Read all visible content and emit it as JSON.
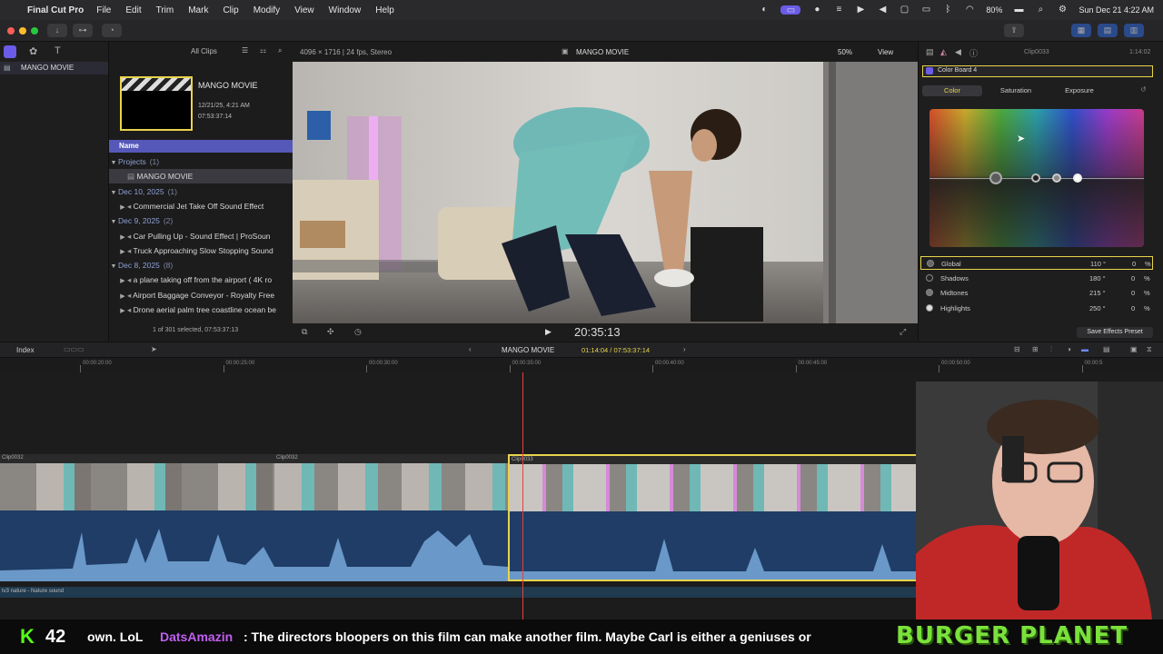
{
  "menubar": {
    "app": "Final Cut Pro",
    "menus": [
      "File",
      "Edit",
      "Trim",
      "Mark",
      "Clip",
      "Modify",
      "View",
      "Window",
      "Help"
    ],
    "battery": "80%",
    "clock": "Sun Dec 21  4:22 AM"
  },
  "browser": {
    "filter": "All Clips",
    "library": "MANGO MOVIE",
    "event_title": "MANGO MOVIE",
    "event_date": "12/21/25, 4:21 AM",
    "event_duration": "07:53:37:14",
    "column_name": "Name",
    "rows": [
      {
        "label": "Projects",
        "count": "(1)",
        "group": true
      },
      {
        "label": "MANGO MOVIE",
        "count": "",
        "group": false,
        "selected": true
      },
      {
        "label": "Dec 10, 2025",
        "count": "(1)",
        "group": true
      },
      {
        "label": "Commercial Jet Take Off Sound Effect",
        "count": "",
        "group": false
      },
      {
        "label": "Dec 9, 2025",
        "count": "(2)",
        "group": true
      },
      {
        "label": "Car Pulling Up - Sound Effect  |  ProSoun",
        "count": "",
        "group": false
      },
      {
        "label": "Truck Approaching Slow Stopping Sound",
        "count": "",
        "group": false
      },
      {
        "label": "Dec 8, 2025",
        "count": "(8)",
        "group": true
      },
      {
        "label": "a plane taking off from the airport ( 4K ro",
        "count": "",
        "group": false
      },
      {
        "label": "Airport Baggage Conveyor - Royalty Free",
        "count": "",
        "group": false
      },
      {
        "label": "Drone aerial palm tree coastline ocean be",
        "count": "",
        "group": false
      }
    ],
    "status": "1 of 301 selected, 07:53:37:13"
  },
  "viewer": {
    "format": "4096 × 1716 | 24 fps, Stereo",
    "title": "MANGO MOVIE",
    "zoom": "50%",
    "view": "View",
    "timecode": "20:35:13"
  },
  "inspector": {
    "clip": "Clip0033",
    "duration": "1:14:02",
    "board": "Color Board 4",
    "tabs": [
      "Color",
      "Saturation",
      "Exposure"
    ],
    "rows": [
      {
        "label": "Global",
        "angle": "110 °",
        "value": "0",
        "unit": "%"
      },
      {
        "label": "Shadows",
        "angle": "180 °",
        "value": "0",
        "unit": "%"
      },
      {
        "label": "Midtones",
        "angle": "215 °",
        "value": "0",
        "unit": "%"
      },
      {
        "label": "Highlights",
        "angle": "250 °",
        "value": "0",
        "unit": "%"
      }
    ],
    "save_preset": "Save Effects Preset"
  },
  "timeline": {
    "index": "Index",
    "project": "MANGO MOVIE",
    "position": "01:14:04 / 07:53:37:14",
    "ruler": [
      "00:00:20:00",
      "00:00:25:00",
      "00:00:30:00",
      "00:00:35:00",
      "00:00:40:00",
      "00:00:45:00",
      "00:00:50:00",
      "00:00:5"
    ],
    "clips": [
      "Clip0032",
      "Clip0032",
      "Clip0033"
    ],
    "audio_label": "tv3 nature - Nature sound"
  },
  "stream": {
    "viewers": "42",
    "chat_pre": "own. LoL",
    "chat_user": "DatsAmazin",
    "chat_msg": ": The directors bloopers on this film can make another film. Maybe Carl is either a geniuses or",
    "brand": "BURGER PLANET"
  },
  "colors": {
    "accent": "#6b5ce7",
    "selection": "#e8d44d",
    "playhead": "#e84040",
    "brand": "#7ae23a"
  }
}
